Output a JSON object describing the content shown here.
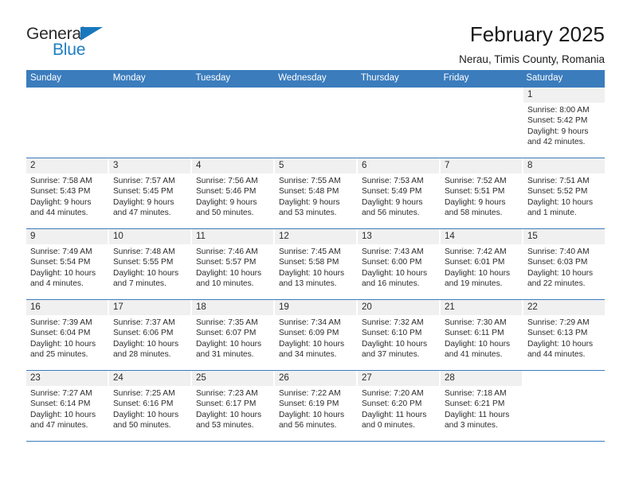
{
  "brand": {
    "name_part1": "General",
    "name_part2": "Blue",
    "logo_icon": "triangle-icon",
    "colors": {
      "blue": "#1878bd",
      "dark": "#2b2b2b"
    }
  },
  "header": {
    "title": "February 2025",
    "subtitle": "Nerau, Timis County, Romania"
  },
  "calendar": {
    "header_bg": "#3b7cbd",
    "daynum_bg": "#f0f0f0",
    "weekdays": [
      "Sunday",
      "Monday",
      "Tuesday",
      "Wednesday",
      "Thursday",
      "Friday",
      "Saturday"
    ],
    "weeks": [
      [
        {
          "day": "",
          "sunrise": "",
          "sunset": "",
          "daylight": "",
          "empty": true
        },
        {
          "day": "",
          "sunrise": "",
          "sunset": "",
          "daylight": "",
          "empty": true
        },
        {
          "day": "",
          "sunrise": "",
          "sunset": "",
          "daylight": "",
          "empty": true
        },
        {
          "day": "",
          "sunrise": "",
          "sunset": "",
          "daylight": "",
          "empty": true
        },
        {
          "day": "",
          "sunrise": "",
          "sunset": "",
          "daylight": "",
          "empty": true
        },
        {
          "day": "",
          "sunrise": "",
          "sunset": "",
          "daylight": "",
          "empty": true
        },
        {
          "day": "1",
          "sunrise": "Sunrise: 8:00 AM",
          "sunset": "Sunset: 5:42 PM",
          "daylight": "Daylight: 9 hours and 42 minutes.",
          "empty": false
        }
      ],
      [
        {
          "day": "2",
          "sunrise": "Sunrise: 7:58 AM",
          "sunset": "Sunset: 5:43 PM",
          "daylight": "Daylight: 9 hours and 44 minutes.",
          "empty": false
        },
        {
          "day": "3",
          "sunrise": "Sunrise: 7:57 AM",
          "sunset": "Sunset: 5:45 PM",
          "daylight": "Daylight: 9 hours and 47 minutes.",
          "empty": false
        },
        {
          "day": "4",
          "sunrise": "Sunrise: 7:56 AM",
          "sunset": "Sunset: 5:46 PM",
          "daylight": "Daylight: 9 hours and 50 minutes.",
          "empty": false
        },
        {
          "day": "5",
          "sunrise": "Sunrise: 7:55 AM",
          "sunset": "Sunset: 5:48 PM",
          "daylight": "Daylight: 9 hours and 53 minutes.",
          "empty": false
        },
        {
          "day": "6",
          "sunrise": "Sunrise: 7:53 AM",
          "sunset": "Sunset: 5:49 PM",
          "daylight": "Daylight: 9 hours and 56 minutes.",
          "empty": false
        },
        {
          "day": "7",
          "sunrise": "Sunrise: 7:52 AM",
          "sunset": "Sunset: 5:51 PM",
          "daylight": "Daylight: 9 hours and 58 minutes.",
          "empty": false
        },
        {
          "day": "8",
          "sunrise": "Sunrise: 7:51 AM",
          "sunset": "Sunset: 5:52 PM",
          "daylight": "Daylight: 10 hours and 1 minute.",
          "empty": false
        }
      ],
      [
        {
          "day": "9",
          "sunrise": "Sunrise: 7:49 AM",
          "sunset": "Sunset: 5:54 PM",
          "daylight": "Daylight: 10 hours and 4 minutes.",
          "empty": false
        },
        {
          "day": "10",
          "sunrise": "Sunrise: 7:48 AM",
          "sunset": "Sunset: 5:55 PM",
          "daylight": "Daylight: 10 hours and 7 minutes.",
          "empty": false
        },
        {
          "day": "11",
          "sunrise": "Sunrise: 7:46 AM",
          "sunset": "Sunset: 5:57 PM",
          "daylight": "Daylight: 10 hours and 10 minutes.",
          "empty": false
        },
        {
          "day": "12",
          "sunrise": "Sunrise: 7:45 AM",
          "sunset": "Sunset: 5:58 PM",
          "daylight": "Daylight: 10 hours and 13 minutes.",
          "empty": false
        },
        {
          "day": "13",
          "sunrise": "Sunrise: 7:43 AM",
          "sunset": "Sunset: 6:00 PM",
          "daylight": "Daylight: 10 hours and 16 minutes.",
          "empty": false
        },
        {
          "day": "14",
          "sunrise": "Sunrise: 7:42 AM",
          "sunset": "Sunset: 6:01 PM",
          "daylight": "Daylight: 10 hours and 19 minutes.",
          "empty": false
        },
        {
          "day": "15",
          "sunrise": "Sunrise: 7:40 AM",
          "sunset": "Sunset: 6:03 PM",
          "daylight": "Daylight: 10 hours and 22 minutes.",
          "empty": false
        }
      ],
      [
        {
          "day": "16",
          "sunrise": "Sunrise: 7:39 AM",
          "sunset": "Sunset: 6:04 PM",
          "daylight": "Daylight: 10 hours and 25 minutes.",
          "empty": false
        },
        {
          "day": "17",
          "sunrise": "Sunrise: 7:37 AM",
          "sunset": "Sunset: 6:06 PM",
          "daylight": "Daylight: 10 hours and 28 minutes.",
          "empty": false
        },
        {
          "day": "18",
          "sunrise": "Sunrise: 7:35 AM",
          "sunset": "Sunset: 6:07 PM",
          "daylight": "Daylight: 10 hours and 31 minutes.",
          "empty": false
        },
        {
          "day": "19",
          "sunrise": "Sunrise: 7:34 AM",
          "sunset": "Sunset: 6:09 PM",
          "daylight": "Daylight: 10 hours and 34 minutes.",
          "empty": false
        },
        {
          "day": "20",
          "sunrise": "Sunrise: 7:32 AM",
          "sunset": "Sunset: 6:10 PM",
          "daylight": "Daylight: 10 hours and 37 minutes.",
          "empty": false
        },
        {
          "day": "21",
          "sunrise": "Sunrise: 7:30 AM",
          "sunset": "Sunset: 6:11 PM",
          "daylight": "Daylight: 10 hours and 41 minutes.",
          "empty": false
        },
        {
          "day": "22",
          "sunrise": "Sunrise: 7:29 AM",
          "sunset": "Sunset: 6:13 PM",
          "daylight": "Daylight: 10 hours and 44 minutes.",
          "empty": false
        }
      ],
      [
        {
          "day": "23",
          "sunrise": "Sunrise: 7:27 AM",
          "sunset": "Sunset: 6:14 PM",
          "daylight": "Daylight: 10 hours and 47 minutes.",
          "empty": false
        },
        {
          "day": "24",
          "sunrise": "Sunrise: 7:25 AM",
          "sunset": "Sunset: 6:16 PM",
          "daylight": "Daylight: 10 hours and 50 minutes.",
          "empty": false
        },
        {
          "day": "25",
          "sunrise": "Sunrise: 7:23 AM",
          "sunset": "Sunset: 6:17 PM",
          "daylight": "Daylight: 10 hours and 53 minutes.",
          "empty": false
        },
        {
          "day": "26",
          "sunrise": "Sunrise: 7:22 AM",
          "sunset": "Sunset: 6:19 PM",
          "daylight": "Daylight: 10 hours and 56 minutes.",
          "empty": false
        },
        {
          "day": "27",
          "sunrise": "Sunrise: 7:20 AM",
          "sunset": "Sunset: 6:20 PM",
          "daylight": "Daylight: 11 hours and 0 minutes.",
          "empty": false
        },
        {
          "day": "28",
          "sunrise": "Sunrise: 7:18 AM",
          "sunset": "Sunset: 6:21 PM",
          "daylight": "Daylight: 11 hours and 3 minutes.",
          "empty": false
        },
        {
          "day": "",
          "sunrise": "",
          "sunset": "",
          "daylight": "",
          "empty": true
        }
      ]
    ]
  }
}
